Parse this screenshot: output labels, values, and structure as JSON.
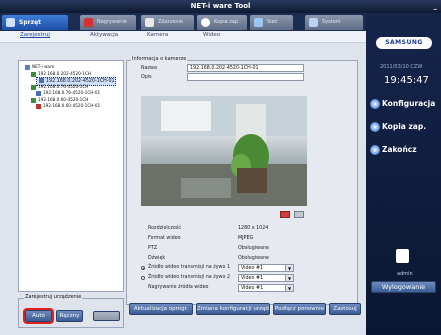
{
  "window": {
    "title": "NET-i ware Tool",
    "min_glyph": "_"
  },
  "tabs": [
    {
      "label": "Sprzęt",
      "icon": "hardware-icon"
    },
    {
      "label": "Nagrywanie",
      "icon": "record-icon"
    },
    {
      "label": "Zdarzenie",
      "icon": "event-icon"
    },
    {
      "label": "Kopia zap.",
      "icon": "backup-icon"
    },
    {
      "label": "Sieć",
      "icon": "network-icon"
    },
    {
      "label": "System",
      "icon": "system-icon"
    }
  ],
  "subnav": [
    "Zarejestruj",
    "Aktywacja",
    "Kamera",
    "Wideo"
  ],
  "tree": {
    "root": "NET-i ware",
    "items": [
      "192.168.0.202-4520-1CH",
      "192.168.0.202-4520-1CH-01",
      "192.168.0.76-4520-1CH",
      "192.168.0.76-4520-1CH-01",
      "192.168.0.60-4520-1CH",
      "192.168.0.60-4520-1CH-01"
    ]
  },
  "device_group": {
    "title": "Zarejestruj urządzenie",
    "auto": "Auto",
    "manual": "Ręczny",
    "third": ""
  },
  "info": {
    "title": "Informacja o kamerze",
    "name_label": "Nazwa",
    "name_value": "192.168.0.202-4520-1CH-01",
    "desc_label": "Opis",
    "desc_value": ""
  },
  "props": [
    {
      "label": "Rozdzielczość",
      "value": "1280 x 1024"
    },
    {
      "label": "Format wideo",
      "value": "MJPEG"
    },
    {
      "label": "PTZ",
      "value": "Obsługiwane"
    },
    {
      "label": "Dźwięk",
      "value": "Obsługiwane"
    }
  ],
  "sources": [
    {
      "label": "Źródło wideo transmisji na żywo 1",
      "value": "Video #1",
      "selected": true
    },
    {
      "label": "Źródło wideo transmisji na żywo 2",
      "value": "Video #1",
      "selected": false
    },
    {
      "label": "Nagrywanie źródła wideo",
      "value": "Video #1",
      "selected": false
    }
  ],
  "bottom_buttons": [
    "Aktualizacja oprogr.",
    "Zmiana konfiguracji urządzeń",
    "Podłącz ponownie",
    "Zastosuj"
  ],
  "sidebar": {
    "brand": "SAMSUNG",
    "date": "2011/03/10 CZW",
    "time": "19:45:47",
    "menu": [
      "Konfiguracja",
      "Kopia zap.",
      "Zakończ"
    ],
    "user": "admin",
    "logout": "Wylogowanie"
  },
  "colors": {
    "accent": "#1d4fa8",
    "highlight": "#e02020",
    "sidebar": "#0e1a33"
  }
}
